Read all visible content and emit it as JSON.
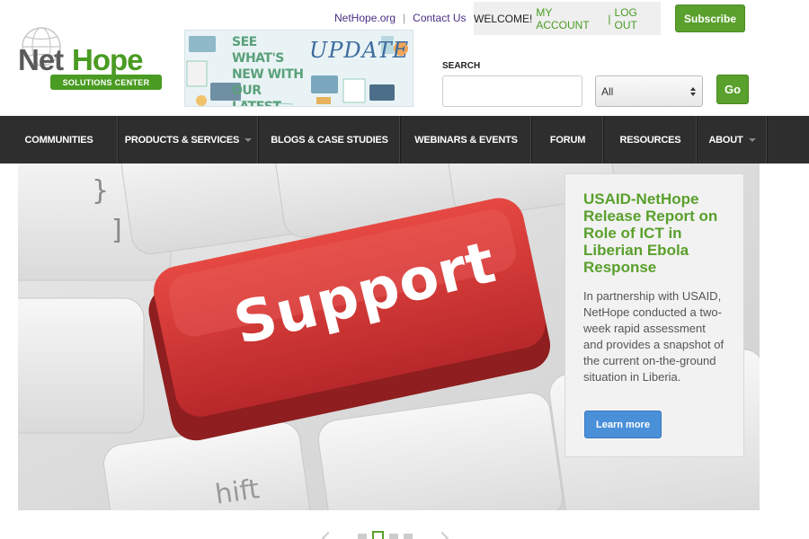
{
  "utility": {
    "link_nethope": "NetHope.org",
    "separator": "|",
    "link_contact": "Contact Us",
    "welcome": "WELCOME!",
    "my_account": "MY ACCOUNT",
    "bar": "|",
    "log_out": "LOG OUT",
    "subscribe": "Subscribe"
  },
  "logo": {
    "net": "Net",
    "hope": "Hope",
    "tagline": "SOLUTIONS CENTER"
  },
  "promo": {
    "text": "SEE WHAT'S NEW WITH OUR LATEST",
    "update": "UPDATE"
  },
  "search": {
    "label": "SEARCH",
    "value": "",
    "select_value": "All",
    "go": "Go"
  },
  "nav": {
    "items": [
      {
        "label": "COMMUNITIES",
        "dropdown": false
      },
      {
        "label": "PRODUCTS & SERVICES",
        "dropdown": true
      },
      {
        "label": "BLOGS & CASE STUDIES",
        "dropdown": false
      },
      {
        "label": "WEBINARS & EVENTS",
        "dropdown": false
      },
      {
        "label": "FORUM",
        "dropdown": false
      },
      {
        "label": "RESOURCES",
        "dropdown": false
      },
      {
        "label": "ABOUT",
        "dropdown": true
      }
    ]
  },
  "hero": {
    "key_label": "Support",
    "title": "USAID-NetHope Release Report on Role of ICT in Liberian Ebola Response",
    "body": "In partnership with USAID, NetHope conducted a two-week rapid assessment and provides a snapshot of the current on-the-ground situation in Liberia.",
    "cta": "Learn more"
  },
  "slider": {
    "total_dots": 4,
    "active_index": 1
  },
  "colors": {
    "brand_green": "#5aa02c",
    "nav_bg": "#2e2e2e",
    "link_purple": "#4b2e83",
    "cta_blue": "#4a90d9",
    "key_red": "#d93a36"
  }
}
